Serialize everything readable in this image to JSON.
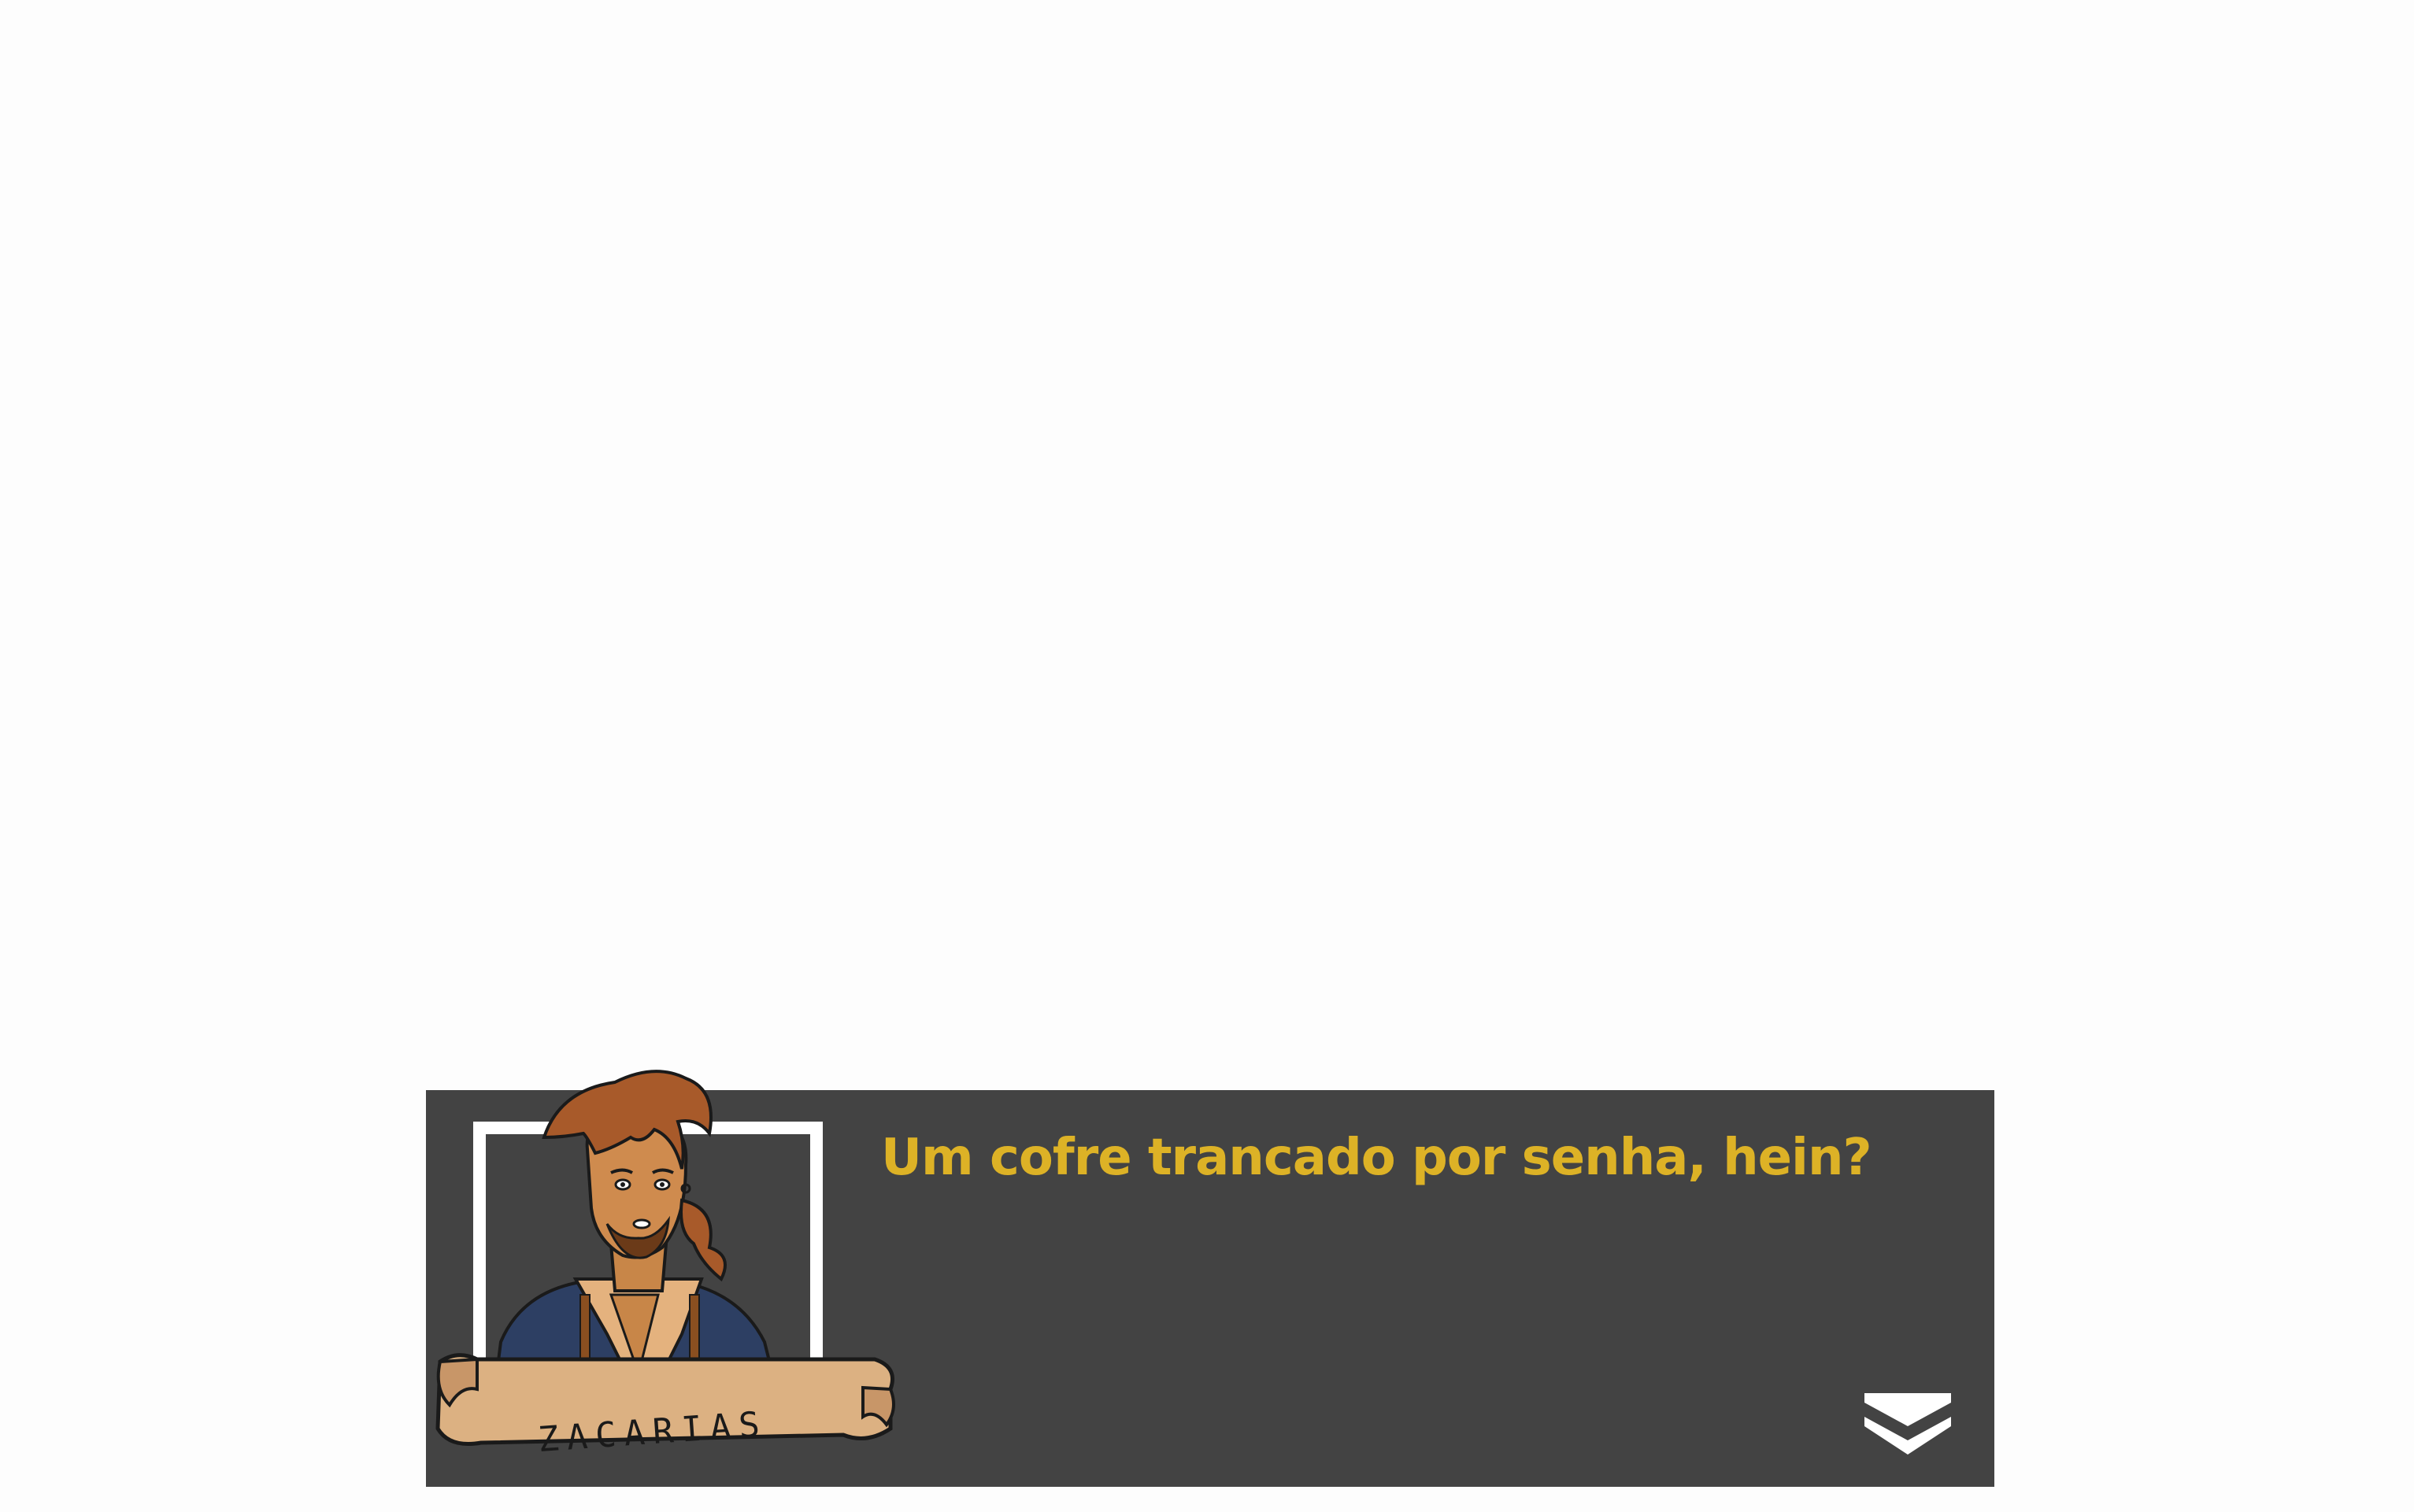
{
  "dialog": {
    "speaker_name": "ZACARIAS",
    "text": "Um cofre trancado por senha, hein?",
    "text_color": "#ddb226",
    "box_color": "#434343"
  },
  "icons": {
    "advance": "double-chevron-down-icon",
    "portrait": "zacarias-portrait"
  }
}
